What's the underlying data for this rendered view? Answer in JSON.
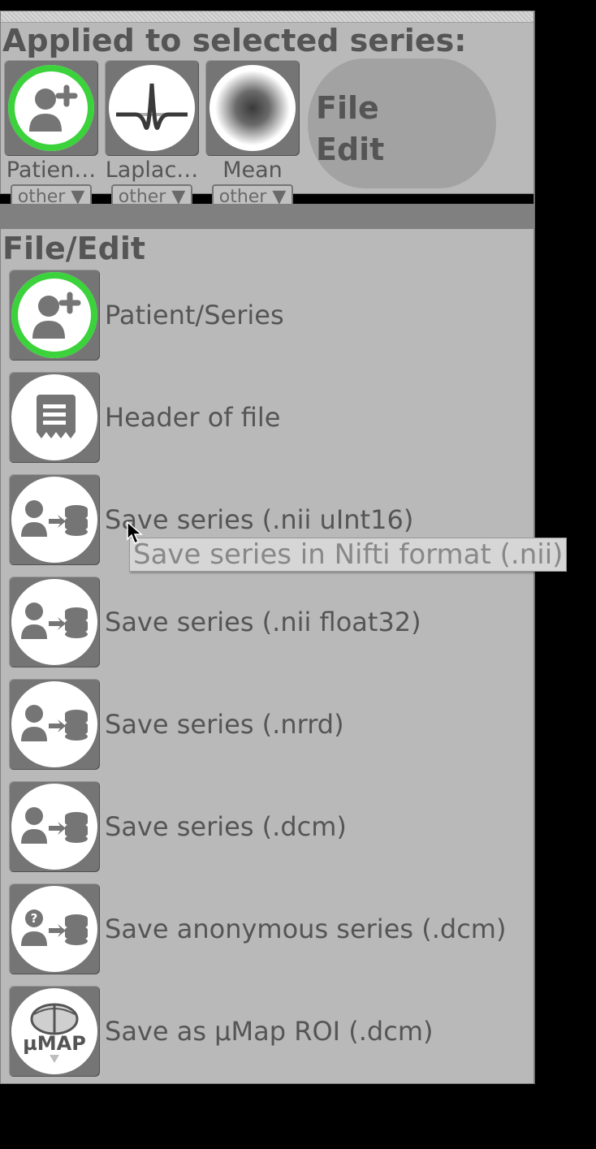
{
  "applied": {
    "title": "Applied to selected series:",
    "cards": [
      {
        "label": "Patien…",
        "dd": "other ▼",
        "icon": "patient"
      },
      {
        "label": "Laplac…",
        "dd": "other ▼",
        "icon": "laplacian"
      },
      {
        "label": "Mean",
        "dd": "other ▼",
        "icon": "mean"
      }
    ],
    "bubble": {
      "line1": "File",
      "line2": "Edit"
    }
  },
  "file_edit": {
    "title": "File/Edit",
    "items": [
      {
        "label": "Patient/Series",
        "icon": "patient",
        "ring": true
      },
      {
        "label": "Header of file",
        "icon": "header",
        "ring": false
      },
      {
        "label": "Save series (.nii uInt16)",
        "icon": "save",
        "ring": false,
        "hover": true
      },
      {
        "label": "Save series (.nii float32)",
        "icon": "save",
        "ring": false
      },
      {
        "label": "Save series (.nrrd)",
        "icon": "save",
        "ring": false
      },
      {
        "label": "Save series (.dcm)",
        "icon": "save",
        "ring": false
      },
      {
        "label": "Save anonymous series (.dcm)",
        "icon": "anon",
        "ring": false
      },
      {
        "label": "Save as µMap ROI (.dcm)",
        "icon": "umap",
        "ring": false
      }
    ]
  },
  "tooltip": "Save series in Nifti format (.nii)",
  "colors": {
    "panel": "#b9b9b9",
    "tile": "#757575",
    "accent": "#3bd23b",
    "hover": "#8aab7f"
  }
}
